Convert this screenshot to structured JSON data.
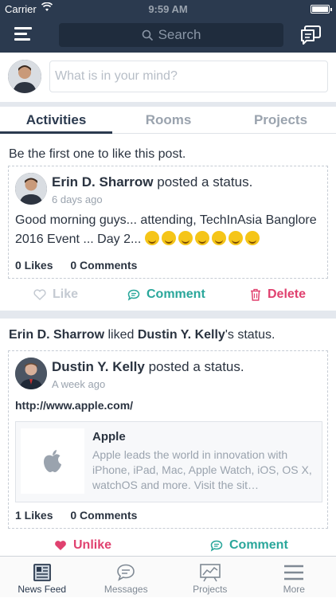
{
  "status_bar": {
    "carrier": "Carrier",
    "time": "9:59 AM"
  },
  "navbar": {
    "search_placeholder": "Search"
  },
  "composer": {
    "placeholder": "What is in your mind?"
  },
  "tabs": [
    {
      "label": "Activities"
    },
    {
      "label": "Rooms"
    },
    {
      "label": "Projects"
    }
  ],
  "posts": [
    {
      "headline": "Be the first one to like this post.",
      "author": "Erin D. Sharrow",
      "action": "posted a status.",
      "time": "6 days ago",
      "body": "Good morning guys... attending, TechInAsia Banglore 2016 Event ... Day 2...",
      "emoji_count": 7,
      "likes": "0 Likes",
      "comments": "0 Comments",
      "like_label": "Like",
      "comment_label": "Comment",
      "delete_label": "Delete"
    },
    {
      "headline_actor": "Erin D. Sharrow",
      "headline_verb": "liked",
      "headline_target": "Dustin Y. Kelly",
      "headline_suffix": "'s status.",
      "author": "Dustin Y. Kelly",
      "action": "posted a status.",
      "time": "A week ago",
      "link": "http://www.apple.com/",
      "preview_title": "Apple",
      "preview_desc": "Apple leads the world in innovation with iPhone, iPad, Mac, Apple Watch, iOS, OS X, watchOS and more. Visit the sit…",
      "likes": "1 Likes",
      "comments": "0 Comments",
      "unlike_label": "Unlike",
      "comment_label": "Comment"
    }
  ],
  "tabbar": [
    {
      "label": "News Feed",
      "icon": "newspaper-icon"
    },
    {
      "label": "Messages",
      "icon": "chat-bubble-icon"
    },
    {
      "label": "Projects",
      "icon": "chart-board-icon"
    },
    {
      "label": "More",
      "icon": "hamburger-icon"
    }
  ],
  "colors": {
    "nav": "#2b3a4f",
    "comment": "#2aa79b",
    "delete": "#e0416f",
    "unlike": "#e0416f"
  }
}
